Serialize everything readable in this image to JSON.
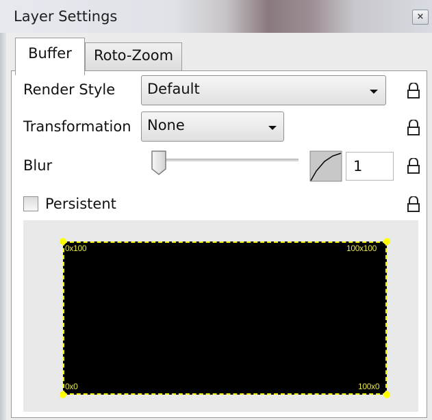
{
  "window": {
    "title": "Layer Settings",
    "close_label": "×"
  },
  "tabs": [
    {
      "label": "Buffer",
      "active": true
    },
    {
      "label": "Roto-Zoom",
      "active": false
    }
  ],
  "fields": {
    "render_style": {
      "label": "Render Style",
      "value": "Default"
    },
    "transformation": {
      "label": "Transformation",
      "value": "None"
    },
    "blur": {
      "label": "Blur",
      "slider_fraction": 0.0,
      "value": "1"
    },
    "persistent": {
      "label": "Persistent",
      "checked": false
    }
  },
  "preview": {
    "top_left": "0x100",
    "top_right": "100x100",
    "bottom_left": "0x0",
    "bottom_right": "100x0"
  },
  "colors": {
    "preview_background": "#000000",
    "preview_border": "#f5f500",
    "handle": "#ffff00"
  },
  "icons": {
    "lock": "lock-icon",
    "curve": "value-curve-icon",
    "dropdown": "chevron-down-icon"
  }
}
